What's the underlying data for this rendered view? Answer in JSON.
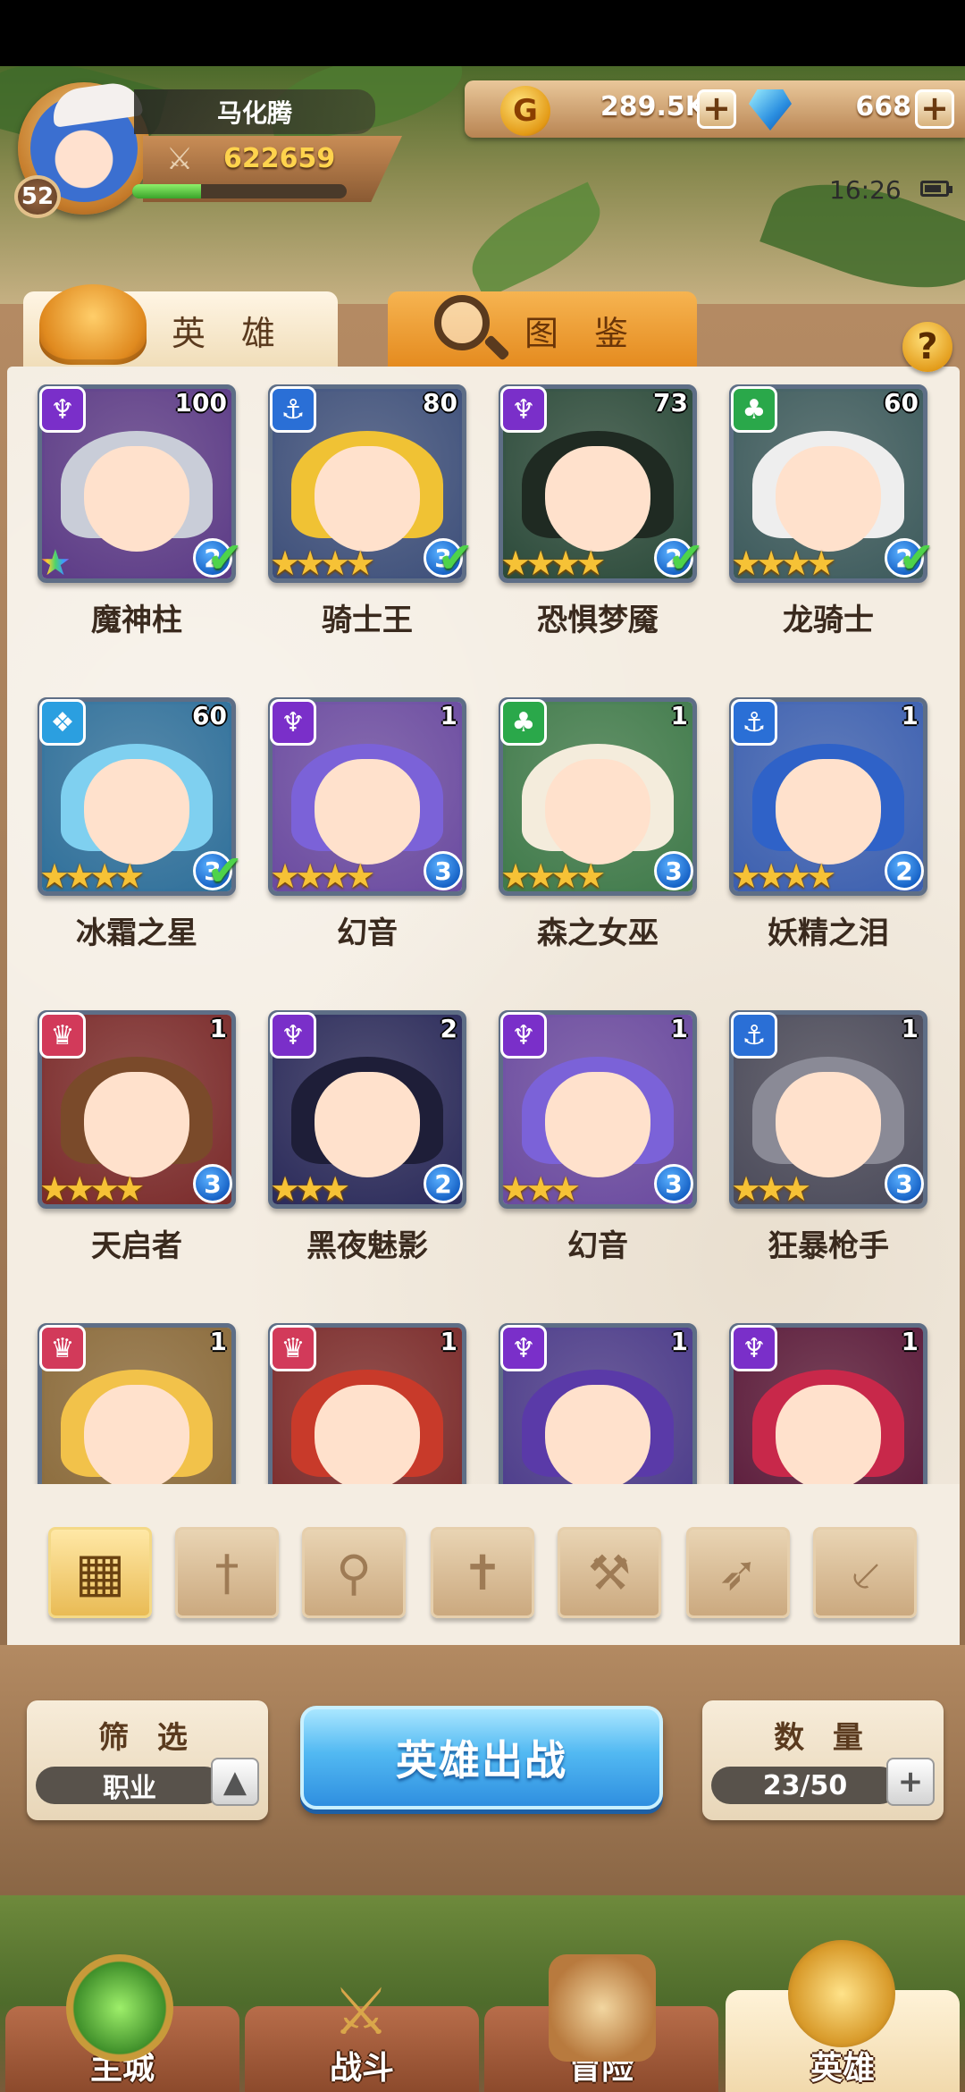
{
  "player": {
    "name": "马化腾",
    "level": "52",
    "power": "622659",
    "exp_fraction": 0.32
  },
  "currency": {
    "gold": "289.5K",
    "gems": "668"
  },
  "status": {
    "time": "16:26"
  },
  "tabs": {
    "hero": "英 雄",
    "codex": "图 鉴"
  },
  "heroes": [
    {
      "name": "魔神柱",
      "level": "100",
      "faction": "demon",
      "stars": 1,
      "rainbow": true,
      "grade": "2",
      "check": true
    },
    {
      "name": "骑士王",
      "level": "80",
      "faction": "anchor",
      "stars": 4,
      "grade": "3",
      "check": true
    },
    {
      "name": "恐惧梦魇",
      "level": "73",
      "faction": "demon",
      "stars": 4,
      "grade": "2",
      "check": true
    },
    {
      "name": "龙骑士",
      "level": "60",
      "faction": "nature",
      "stars": 4,
      "grade": "2",
      "check": true
    },
    {
      "name": "冰霜之星",
      "level": "60",
      "faction": "ice",
      "stars": 4,
      "grade": "3",
      "check": true
    },
    {
      "name": "幻音",
      "level": "1",
      "faction": "demon",
      "stars": 4,
      "grade": "3",
      "check": false
    },
    {
      "name": "森之女巫",
      "level": "1",
      "faction": "nature",
      "stars": 4,
      "grade": "3",
      "check": false
    },
    {
      "name": "妖精之泪",
      "level": "1",
      "faction": "anchor",
      "stars": 4,
      "grade": "2",
      "check": false
    },
    {
      "name": "天启者",
      "level": "1",
      "faction": "fire",
      "stars": 4,
      "grade": "3",
      "check": false
    },
    {
      "name": "黑夜魅影",
      "level": "2",
      "faction": "demon",
      "stars": 3,
      "grade": "2",
      "check": false
    },
    {
      "name": "幻音",
      "level": "1",
      "faction": "demon",
      "stars": 3,
      "grade": "3",
      "check": false
    },
    {
      "name": "狂暴枪手",
      "level": "1",
      "faction": "anchor",
      "stars": 3,
      "grade": "3",
      "check": false
    },
    {
      "name": "",
      "level": "1",
      "faction": "fire",
      "stars": 0,
      "grade": "",
      "check": false
    },
    {
      "name": "",
      "level": "1",
      "faction": "fire",
      "stars": 0,
      "grade": "",
      "check": false
    },
    {
      "name": "",
      "level": "1",
      "faction": "demon",
      "stars": 0,
      "grade": "",
      "check": false
    },
    {
      "name": "",
      "level": "1",
      "faction": "demon",
      "stars": 0,
      "grade": "",
      "check": false
    }
  ],
  "faction_colors": {
    "demon": "#7a2fc9",
    "anchor": "#2a6fd6",
    "nature": "#2aa84a",
    "ice": "#2b9fe0",
    "fire": "#d23a5a"
  },
  "class_filters": [
    "all-grid-icon",
    "sword-icon",
    "staff-icon",
    "cross-icon",
    "axe-icon",
    "bow-icon",
    "dagger-icon"
  ],
  "controls": {
    "filter_title": "筛 选",
    "filter_value": "职业",
    "deploy_label": "英雄出战",
    "count_title": "数 量",
    "count_value": "23/50"
  },
  "nav": {
    "city": "主城",
    "battle": "战斗",
    "adventure": "冒险",
    "hero": "英雄"
  }
}
